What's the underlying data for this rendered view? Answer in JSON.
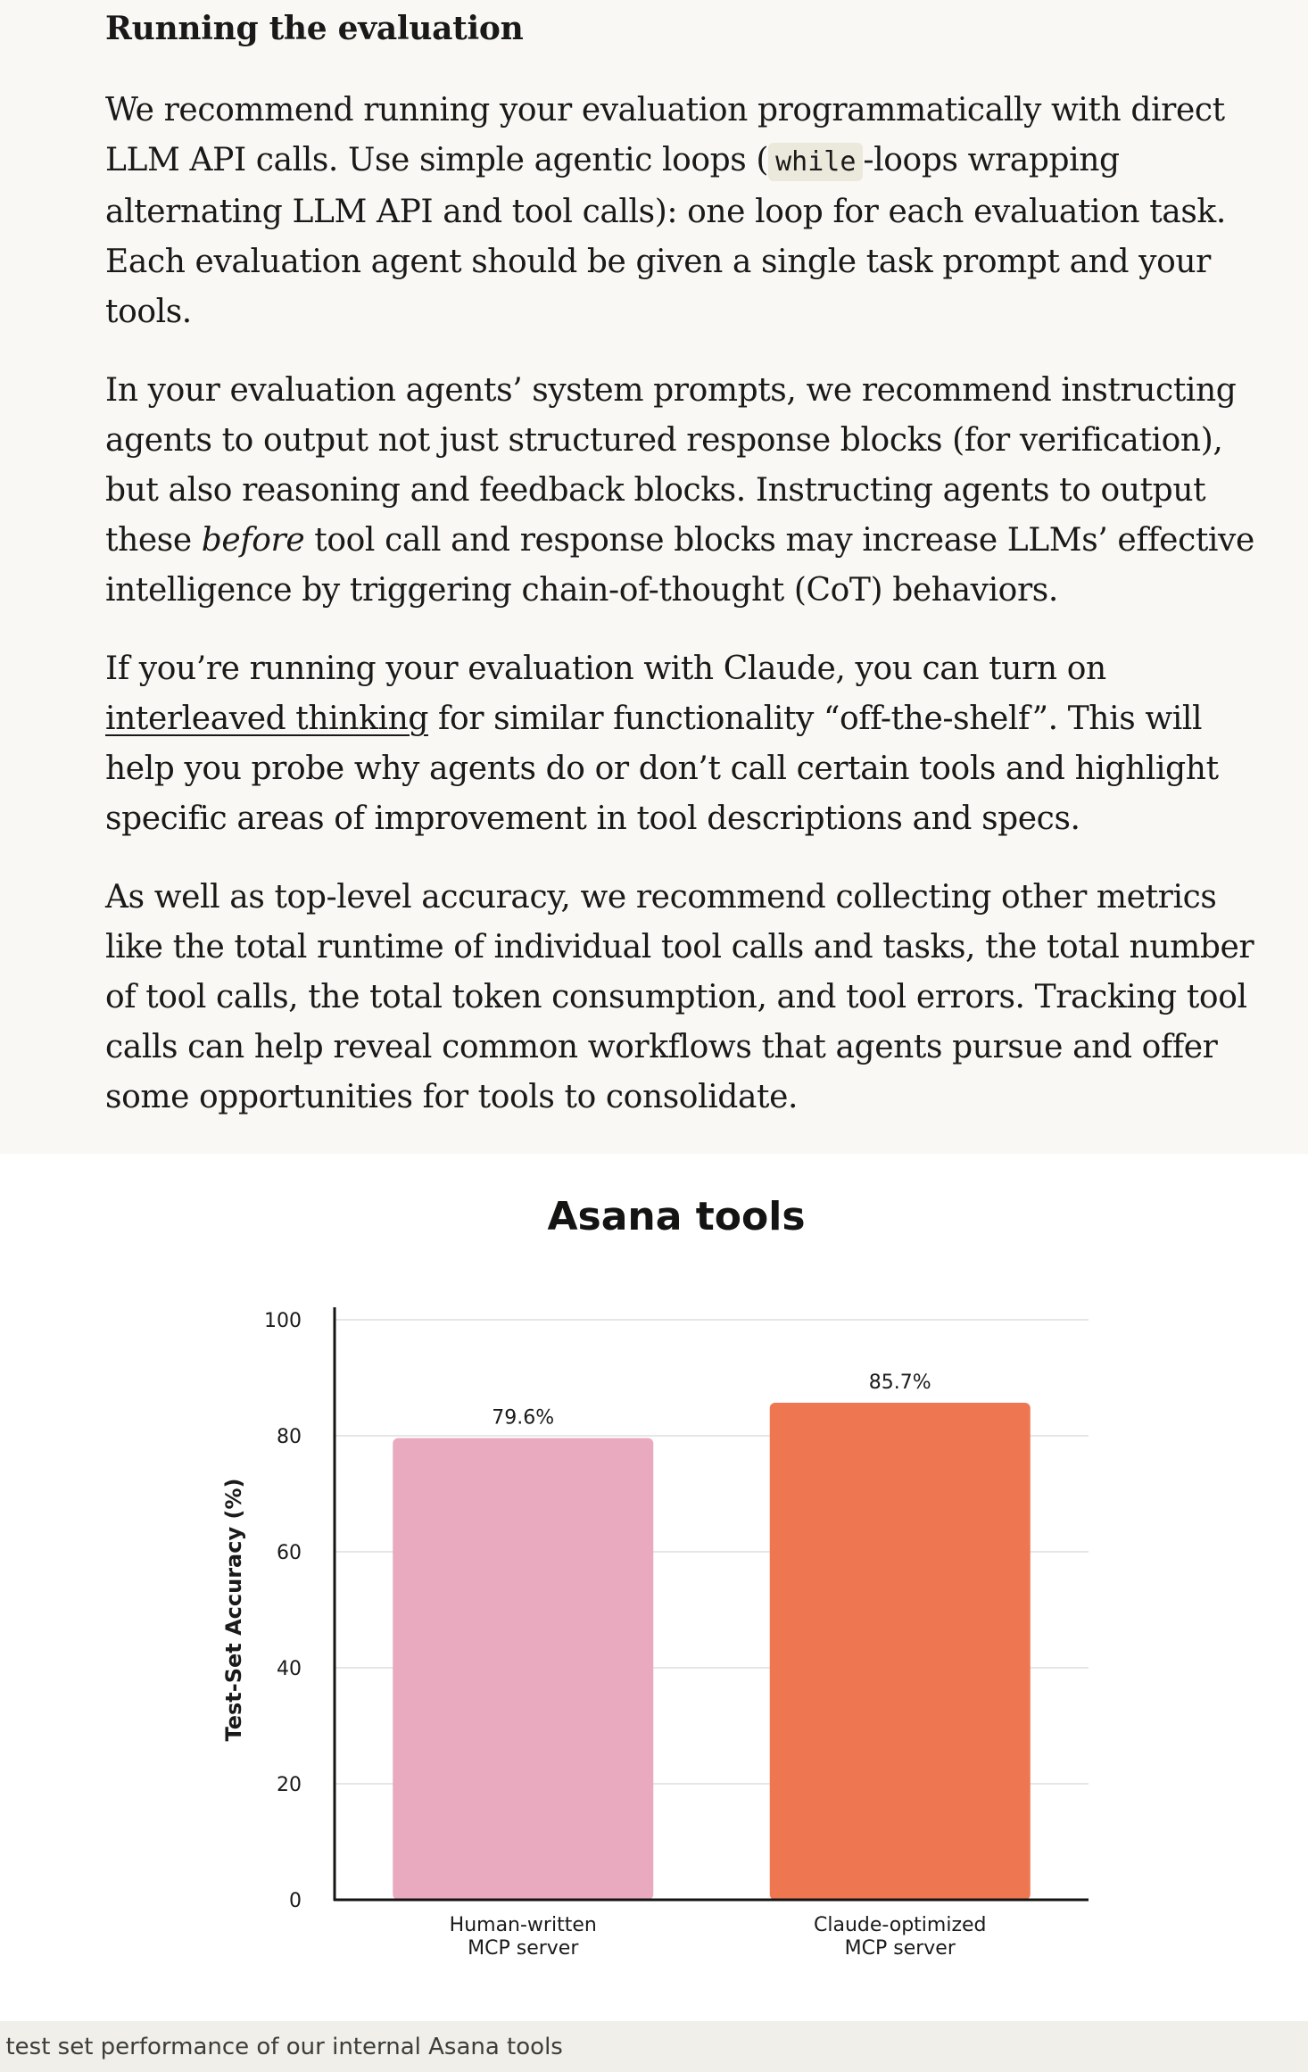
{
  "article": {
    "heading": "Running the evaluation",
    "p1": {
      "a": "We recommend running your evaluation programmatically with direct LLM API calls. Use simple agentic loops (",
      "code": "while",
      "b": "-loops wrapping alternating LLM API and tool calls): one loop for each evaluation task. Each evaluation agent should be given a single task prompt and your tools."
    },
    "p2": {
      "a": "In your evaluation agents’ system prompts, we recommend instructing agents to output not just structured response blocks (for verification), but also reasoning and feedback blocks. Instructing agents to output these ",
      "em": "before",
      "b": " tool call and response blocks may increase LLMs’ effective intelligence by triggering chain-of-thought (CoT) behaviors."
    },
    "p3": {
      "a": "If you’re running your evaluation with Claude, you can turn on ",
      "link": "interleaved thinking",
      "b": " for similar functionality “off-the-shelf”. This will help you probe why agents do or don’t call certain tools and highlight specific areas of improvement in tool descriptions and specs."
    },
    "p4": "As well as top-level accuracy, we recommend collecting other metrics like the total runtime of individual tool calls and tasks, the total number of tool calls, the total token consumption, and tool errors. Tracking tool calls can help reveal common workflows that agents pursue and offer some opportunities for tools to consolidate."
  },
  "chart_data": {
    "type": "bar",
    "title": "Asana tools",
    "ylabel": "Test-Set Accuracy (%)",
    "xlabel": "",
    "ylim": [
      0,
      100
    ],
    "yticks": [
      0,
      20,
      40,
      60,
      80,
      100
    ],
    "grid": true,
    "categories": [
      [
        "Human-written",
        "MCP server"
      ],
      [
        "Claude-optimized",
        "MCP server"
      ]
    ],
    "values": [
      79.6,
      85.7
    ],
    "labels": [
      "79.6%",
      "85.7%"
    ],
    "colors": [
      "#e9aabf",
      "#ee7651"
    ]
  },
  "caption": "t test set performance of our internal Asana tools"
}
